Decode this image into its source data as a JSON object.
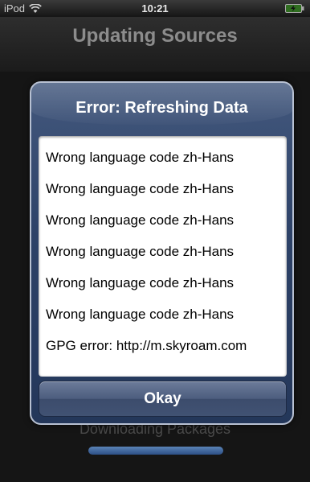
{
  "status_bar": {
    "carrier": "iPod",
    "time": "10:21",
    "wifi_icon": "wifi-icon",
    "battery_icon": "battery-icon"
  },
  "nav": {
    "title": "Updating Sources"
  },
  "background": {
    "label": "Downloading Packages",
    "progress_color": "#3b6198"
  },
  "alert": {
    "title": "Error: Refreshing Data",
    "messages": [
      "Wrong language code zh-Hans",
      "Wrong language code zh-Hans",
      "Wrong language code zh-Hans",
      "Wrong language code zh-Hans",
      "Wrong language code zh-Hans",
      "Wrong language code zh-Hans",
      "GPG error: http://m.skyroam.com"
    ],
    "button_label": "Okay",
    "accent": "#2d4268"
  }
}
